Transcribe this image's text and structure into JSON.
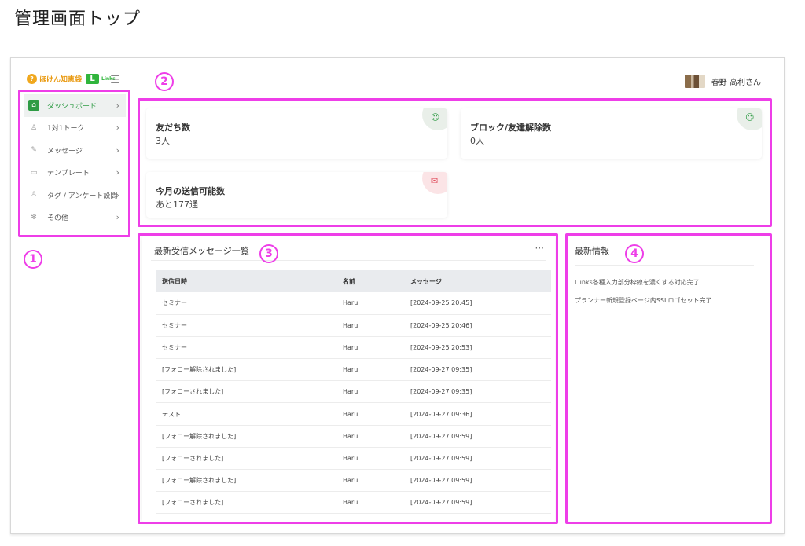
{
  "doc_title": "管理画面トップ",
  "logo": {
    "text": "ほけん知恵袋",
    "badge": "?",
    "l_mark": "L",
    "l_sub": "Links"
  },
  "hamburger": "☰",
  "nav": [
    {
      "label": "ダッシュボード",
      "icon": "home-icon",
      "glyph": "⌂",
      "active": true
    },
    {
      "label": "1対1トーク",
      "icon": "user-icon",
      "glyph": "♙",
      "active": false
    },
    {
      "label": "メッセージ",
      "icon": "edit-icon",
      "glyph": "✎",
      "active": false
    },
    {
      "label": "テンプレート",
      "icon": "calendar-icon",
      "glyph": "▭",
      "active": false
    },
    {
      "label": "タグ / アンケート設問",
      "icon": "tag-user-icon",
      "glyph": "♙",
      "active": false
    },
    {
      "label": "その他",
      "icon": "gear-icon",
      "glyph": "✻",
      "active": false
    }
  ],
  "chevron": "›",
  "user": {
    "name": "春野 高利さん"
  },
  "markers": [
    "1",
    "2",
    "3",
    "4"
  ],
  "cards": {
    "friends": {
      "title": "友だち数",
      "value": "3人",
      "icon_glyph": "☺"
    },
    "blocked": {
      "title": "ブロック/友達解除数",
      "value": "0人",
      "icon_glyph": "☺"
    },
    "send": {
      "title": "今月の送信可能数",
      "value": "あと177通",
      "icon_glyph": "✉"
    }
  },
  "messages": {
    "title": "最新受信メッセージ一覧",
    "more": "···",
    "headers": [
      "送信日時",
      "名前",
      "メッセージ"
    ],
    "rows": [
      [
        "セミナー",
        "Haru",
        "[2024-09-25 20:45]"
      ],
      [
        "セミナー",
        "Haru",
        "[2024-09-25 20:46]"
      ],
      [
        "セミナー",
        "Haru",
        "[2024-09-25 20:53]"
      ],
      [
        "[フォロー解除されました]",
        "Haru",
        "[2024-09-27 09:35]"
      ],
      [
        "[フォローされました]",
        "Haru",
        "[2024-09-27 09:35]"
      ],
      [
        "テスト",
        "Haru",
        "[2024-09-27 09:36]"
      ],
      [
        "[フォロー解除されました]",
        "Haru",
        "[2024-09-27 09:59]"
      ],
      [
        "[フォローされました]",
        "Haru",
        "[2024-09-27 09:59]"
      ],
      [
        "[フォロー解除されました]",
        "Haru",
        "[2024-09-27 09:59]"
      ],
      [
        "[フォローされました]",
        "Haru",
        "[2024-09-27 09:59]"
      ]
    ]
  },
  "news": {
    "title": "最新情報",
    "items": [
      "Llinks各種入力部分枠線を濃くする対応完了",
      "プランナー新規登録ページ内SSLロゴセット完了"
    ]
  },
  "colors": {
    "highlight": "#ee3ee8",
    "accent_green": "#2e9b44",
    "alert_red": "#e0505f"
  }
}
